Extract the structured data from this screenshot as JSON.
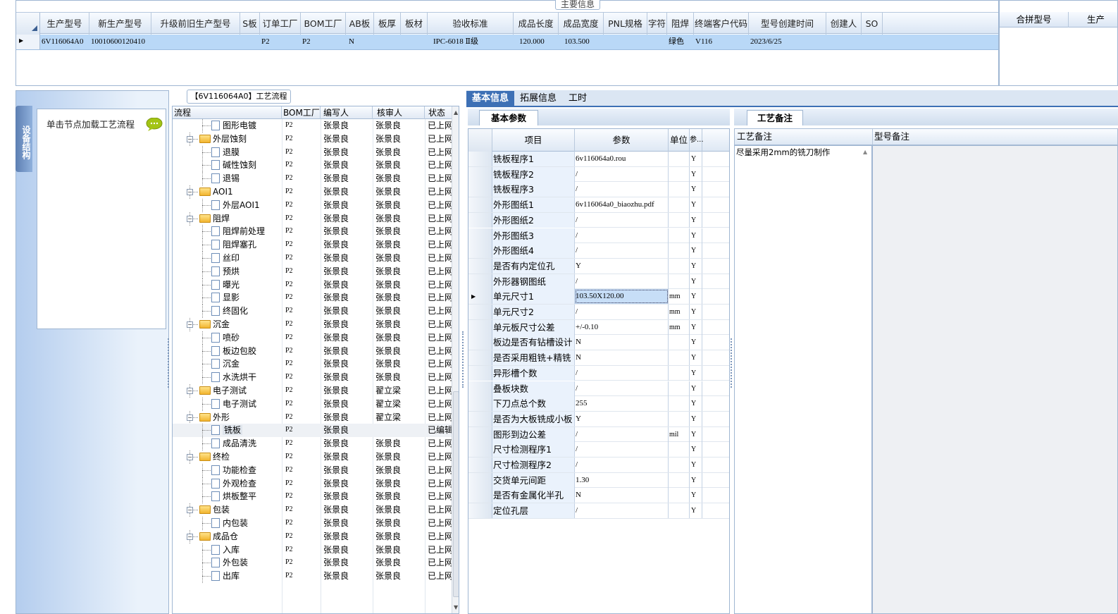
{
  "top": {
    "main_info_tab": "主要信息",
    "columns": [
      "生产型号",
      "新生产型号",
      "升级前旧生产型号",
      "S板",
      "订单工厂",
      "BOM工厂",
      "AB板",
      "板厚",
      "板材",
      "验收标准",
      "成品长度",
      "成品宽度",
      "PNL规格",
      "字符",
      "阻焊",
      "终端客户代码",
      "型号创建时间",
      "创建人",
      "SO"
    ],
    "row": [
      "6V116064A0",
      "10010600120410",
      "",
      "",
      "P2",
      "P2",
      "N",
      "",
      "",
      "IPC-6018 Ⅱ级",
      "120.000",
      "103.500",
      "",
      "",
      "绿色",
      "V116",
      "2023/6/25",
      "",
      ""
    ],
    "merge_columns": [
      "合拼型号",
      "生产"
    ]
  },
  "left": {
    "side_tab": "设备结构",
    "hint": "单击节点加载工艺流程"
  },
  "flow": {
    "title": "【6V116064A0】工艺流程",
    "headers": [
      "流程",
      "BOM工厂",
      "编写人",
      "核审人",
      "状态"
    ],
    "rows": [
      {
        "lvl": 2,
        "name": "图形电镀",
        "bom": "P2",
        "w": "张景良",
        "r": "张景良",
        "s": "已上网"
      },
      {
        "lvl": 1,
        "name": "外层蚀刻",
        "bom": "P2",
        "w": "张景良",
        "r": "张景良",
        "s": "已上网"
      },
      {
        "lvl": 2,
        "name": "退膜",
        "bom": "P2",
        "w": "张景良",
        "r": "张景良",
        "s": "已上网"
      },
      {
        "lvl": 2,
        "name": "碱性蚀刻",
        "bom": "P2",
        "w": "张景良",
        "r": "张景良",
        "s": "已上网"
      },
      {
        "lvl": 2,
        "name": "退锡",
        "bom": "P2",
        "w": "张景良",
        "r": "张景良",
        "s": "已上网"
      },
      {
        "lvl": 1,
        "name": "AOI1",
        "bom": "P2",
        "w": "张景良",
        "r": "张景良",
        "s": "已上网"
      },
      {
        "lvl": 2,
        "name": "外层AOI1",
        "bom": "P2",
        "w": "张景良",
        "r": "张景良",
        "s": "已上网"
      },
      {
        "lvl": 1,
        "name": "阻焊",
        "bom": "P2",
        "w": "张景良",
        "r": "张景良",
        "s": "已上网"
      },
      {
        "lvl": 2,
        "name": "阻焊前处理",
        "bom": "P2",
        "w": "张景良",
        "r": "张景良",
        "s": "已上网"
      },
      {
        "lvl": 2,
        "name": "阻焊塞孔",
        "bom": "P2",
        "w": "张景良",
        "r": "张景良",
        "s": "已上网"
      },
      {
        "lvl": 2,
        "name": "丝印",
        "bom": "P2",
        "w": "张景良",
        "r": "张景良",
        "s": "已上网"
      },
      {
        "lvl": 2,
        "name": "预烘",
        "bom": "P2",
        "w": "张景良",
        "r": "张景良",
        "s": "已上网"
      },
      {
        "lvl": 2,
        "name": "曝光",
        "bom": "P2",
        "w": "张景良",
        "r": "张景良",
        "s": "已上网"
      },
      {
        "lvl": 2,
        "name": "显影",
        "bom": "P2",
        "w": "张景良",
        "r": "张景良",
        "s": "已上网"
      },
      {
        "lvl": 2,
        "name": "终固化",
        "bom": "P2",
        "w": "张景良",
        "r": "张景良",
        "s": "已上网"
      },
      {
        "lvl": 1,
        "name": "沉金",
        "bom": "P2",
        "w": "张景良",
        "r": "张景良",
        "s": "已上网"
      },
      {
        "lvl": 2,
        "name": "喷砂",
        "bom": "P2",
        "w": "张景良",
        "r": "张景良",
        "s": "已上网"
      },
      {
        "lvl": 2,
        "name": "板边包胶",
        "bom": "P2",
        "w": "张景良",
        "r": "张景良",
        "s": "已上网"
      },
      {
        "lvl": 2,
        "name": "沉金",
        "bom": "P2",
        "w": "张景良",
        "r": "张景良",
        "s": "已上网"
      },
      {
        "lvl": 2,
        "name": "水洗烘干",
        "bom": "P2",
        "w": "张景良",
        "r": "张景良",
        "s": "已上网"
      },
      {
        "lvl": 1,
        "name": "电子测试",
        "bom": "P2",
        "w": "张景良",
        "r": "翟立梁",
        "s": "已上网"
      },
      {
        "lvl": 2,
        "name": "电子测试",
        "bom": "P2",
        "w": "张景良",
        "r": "翟立梁",
        "s": "已上网"
      },
      {
        "lvl": 1,
        "name": "外形",
        "bom": "P2",
        "w": "张景良",
        "r": "翟立梁",
        "s": "已上网"
      },
      {
        "lvl": 2,
        "name": "铣板",
        "bom": "P2",
        "w": "张景良",
        "r": "",
        "s": "已编辑",
        "sel": true
      },
      {
        "lvl": 2,
        "name": "成品清洗",
        "bom": "P2",
        "w": "张景良",
        "r": "张景良",
        "s": "已上网"
      },
      {
        "lvl": 1,
        "name": "终检",
        "bom": "P2",
        "w": "张景良",
        "r": "张景良",
        "s": "已上网"
      },
      {
        "lvl": 2,
        "name": "功能检查",
        "bom": "P2",
        "w": "张景良",
        "r": "张景良",
        "s": "已上网"
      },
      {
        "lvl": 2,
        "name": "外观检查",
        "bom": "P2",
        "w": "张景良",
        "r": "张景良",
        "s": "已上网"
      },
      {
        "lvl": 2,
        "name": "烘板整平",
        "bom": "P2",
        "w": "张景良",
        "r": "张景良",
        "s": "已上网"
      },
      {
        "lvl": 1,
        "name": "包装",
        "bom": "P2",
        "w": "张景良",
        "r": "张景良",
        "s": "已上网"
      },
      {
        "lvl": 2,
        "name": "内包装",
        "bom": "P2",
        "w": "张景良",
        "r": "张景良",
        "s": "已上网"
      },
      {
        "lvl": 1,
        "name": "成品仓",
        "bom": "P2",
        "w": "张景良",
        "r": "张景良",
        "s": "已上网"
      },
      {
        "lvl": 2,
        "name": "入库",
        "bom": "P2",
        "w": "张景良",
        "r": "张景良",
        "s": "已上网"
      },
      {
        "lvl": 2,
        "name": "外包装",
        "bom": "P2",
        "w": "张景良",
        "r": "张景良",
        "s": "已上网"
      },
      {
        "lvl": 2,
        "name": "出库",
        "bom": "P2",
        "w": "张景良",
        "r": "张景良",
        "s": "已上网"
      }
    ]
  },
  "tabs": [
    "基本信息",
    "拓展信息",
    "工时"
  ],
  "params": {
    "sub_tab": "基本参数",
    "headers": [
      "项目",
      "参数",
      "单位",
      "参..."
    ],
    "rows": [
      {
        "k": "铣板程序1",
        "v": "6v116064a0.rou",
        "u": "",
        "y": "Y"
      },
      {
        "k": "铣板程序2",
        "v": "/",
        "u": "",
        "y": "Y"
      },
      {
        "k": "铣板程序3",
        "v": "/",
        "u": "",
        "y": "Y"
      },
      {
        "k": "外形图纸1",
        "v": "6v116064a0_biaozhu.pdf",
        "u": "",
        "y": "Y"
      },
      {
        "k": "外形图纸2",
        "v": "/",
        "u": "",
        "y": "Y"
      },
      {
        "k": "外形图纸3",
        "v": "/",
        "u": "",
        "y": "Y"
      },
      {
        "k": "外形图纸4",
        "v": "/",
        "u": "",
        "y": "Y"
      },
      {
        "k": "是否有内定位孔",
        "v": "Y",
        "u": "",
        "y": "Y"
      },
      {
        "k": "外形器钢图纸",
        "v": "/",
        "u": "",
        "y": "Y"
      },
      {
        "k": "单元尺寸1",
        "v": "103.50X120.00",
        "u": "mm",
        "y": "Y",
        "cur": true
      },
      {
        "k": "单元尺寸2",
        "v": "/",
        "u": "mm",
        "y": "Y"
      },
      {
        "k": "单元板尺寸公差",
        "v": "+/-0.10",
        "u": "mm",
        "y": "Y"
      },
      {
        "k": "板边是否有钻槽设计",
        "v": "N",
        "u": "",
        "y": "Y"
      },
      {
        "k": "是否采用粗铣+精铣",
        "v": "N",
        "u": "",
        "y": "Y"
      },
      {
        "k": "异形槽个数",
        "v": "/",
        "u": "",
        "y": "Y"
      },
      {
        "k": "叠板块数",
        "v": "/",
        "u": "",
        "y": "Y"
      },
      {
        "k": "下刀点总个数",
        "v": "255",
        "u": "",
        "y": "Y"
      },
      {
        "k": "是否为大板铣成小板",
        "v": "Y",
        "u": "",
        "y": "Y"
      },
      {
        "k": "图形到边公差",
        "v": "/",
        "u": "mil",
        "y": "Y"
      },
      {
        "k": "尺寸检测程序1",
        "v": "/",
        "u": "",
        "y": "Y"
      },
      {
        "k": "尺寸检测程序2",
        "v": "/",
        "u": "",
        "y": "Y"
      },
      {
        "k": "交货单元间距",
        "v": "1.30",
        "u": "",
        "y": "Y"
      },
      {
        "k": "是否有金属化半孔",
        "v": "N",
        "u": "",
        "y": "Y"
      },
      {
        "k": "定位孔层",
        "v": "/",
        "u": "",
        "y": "Y"
      }
    ]
  },
  "notes": {
    "tab": "工艺备注",
    "col1": "工艺备注",
    "col2": "型号备注",
    "text": "尽量采用2mm的铣刀制作"
  }
}
